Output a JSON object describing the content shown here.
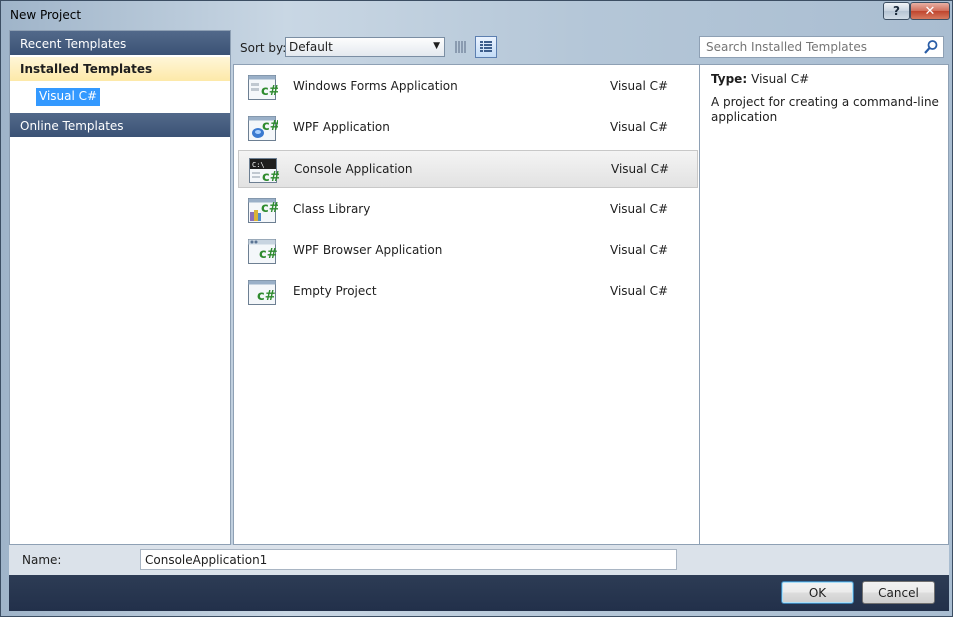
{
  "window": {
    "title": "New Project",
    "help_label": "?",
    "close_label": "✕"
  },
  "sidebar": {
    "items": [
      {
        "label": "Recent Templates"
      },
      {
        "label": "Installed Templates",
        "selected": true
      },
      {
        "label": "Online Templates"
      }
    ],
    "tree": {
      "label": "Visual C#",
      "selected": true
    }
  },
  "toolbar": {
    "sort_label": "Sort by:",
    "sort_value": "Default",
    "view_small_icons": "small-icons-view",
    "view_list": "list-view",
    "active_view": "list"
  },
  "search": {
    "placeholder": "Search Installed Templates"
  },
  "templates": [
    {
      "name": "Windows Forms Application",
      "language": "Visual C#",
      "icon": "windows-forms-icon"
    },
    {
      "name": "WPF Application",
      "language": "Visual C#",
      "icon": "wpf-icon"
    },
    {
      "name": "Console Application",
      "language": "Visual C#",
      "icon": "console-icon",
      "selected": true
    },
    {
      "name": "Class Library",
      "language": "Visual C#",
      "icon": "class-library-icon"
    },
    {
      "name": "WPF Browser Application",
      "language": "Visual C#",
      "icon": "wpf-browser-icon"
    },
    {
      "name": "Empty Project",
      "language": "Visual C#",
      "icon": "empty-project-icon"
    }
  ],
  "details": {
    "type_label": "Type:",
    "type_value": "Visual C#",
    "description": "A project for creating a command-line application"
  },
  "name_field": {
    "label": "Name:",
    "value": "ConsoleApplication1"
  },
  "buttons": {
    "ok": "OK",
    "cancel": "Cancel"
  },
  "colors": {
    "selection": "#3399ff",
    "header_bar": "#3b5275",
    "installed_highlight": "#fde9a8",
    "csharp_green": "#2e8b2e"
  }
}
